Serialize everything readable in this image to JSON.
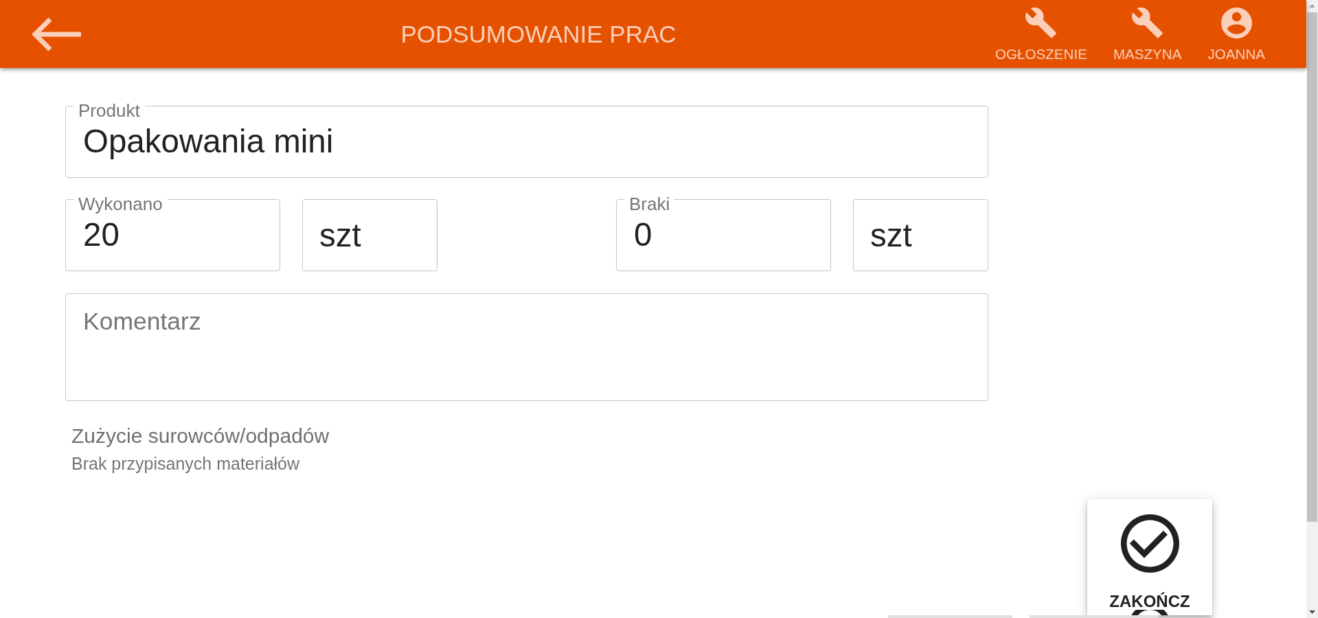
{
  "header": {
    "title": "PODSUMOWANIE PRAC",
    "actions": [
      {
        "kind": "wrench",
        "label": "OGŁOSZENIE"
      },
      {
        "kind": "wrench",
        "label": "MASZYNA"
      },
      {
        "kind": "account",
        "label": "JOANNA"
      }
    ]
  },
  "form": {
    "product": {
      "label": "Produkt",
      "value": "Opakowania mini"
    },
    "quantities": [
      {
        "label": "Wykonano",
        "value": "20",
        "unit": "szt"
      },
      {
        "label": "Braki",
        "value": "0",
        "unit": "szt"
      }
    ],
    "comment": {
      "placeholder": "Komentarz"
    },
    "materials": {
      "title": "Zużycie surowców/odpadów",
      "message": "Brak przypisanych materiałów"
    }
  },
  "finish_button": {
    "label": "ZAKOŃCZ"
  }
}
